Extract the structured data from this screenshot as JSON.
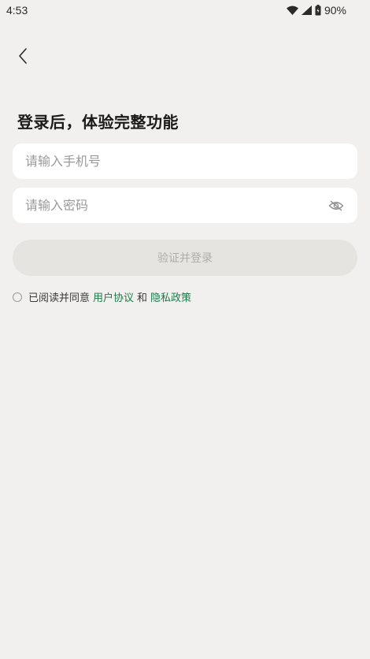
{
  "status_bar": {
    "time": "4:53",
    "battery": "90%",
    "icons": [
      "wifi-icon",
      "signal-icon",
      "battery-icon"
    ]
  },
  "header": {
    "back_icon": "chevron-left-icon"
  },
  "title": "登录后，体验完整功能",
  "phone_field": {
    "placeholder": "请输入手机号",
    "value": ""
  },
  "password_field": {
    "placeholder": "请输入密码",
    "value": "",
    "toggle_icon": "eye-off-icon"
  },
  "login_button": {
    "label": "验证并登录"
  },
  "agreement": {
    "prefix": "已阅读并同意",
    "user_agreement": "用户协议",
    "conjunction": "和",
    "privacy_policy": "隐私政策",
    "checked": false
  },
  "colors": {
    "background": "#f1f0ee",
    "field_background": "#ffffff",
    "button_disabled": "#e5e4e0",
    "button_text_disabled": "#adadaa",
    "link": "#1d7a4a"
  }
}
